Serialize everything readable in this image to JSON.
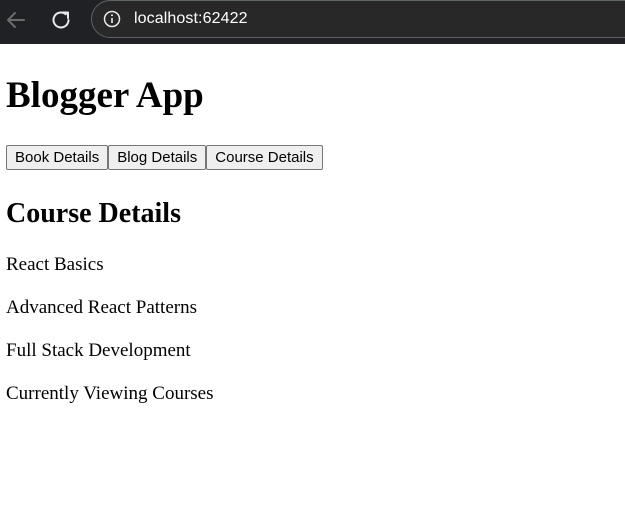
{
  "browser": {
    "url": "localhost:62422",
    "background": "#202124"
  },
  "app": {
    "title": "Blogger App",
    "buttons": [
      "Book Details",
      "Blog Details",
      "Course Details"
    ]
  },
  "section": {
    "title": "Course Details",
    "courses": [
      "React Basics",
      "Advanced React Patterns",
      "Full Stack Development"
    ],
    "status": "Currently Viewing Courses"
  }
}
